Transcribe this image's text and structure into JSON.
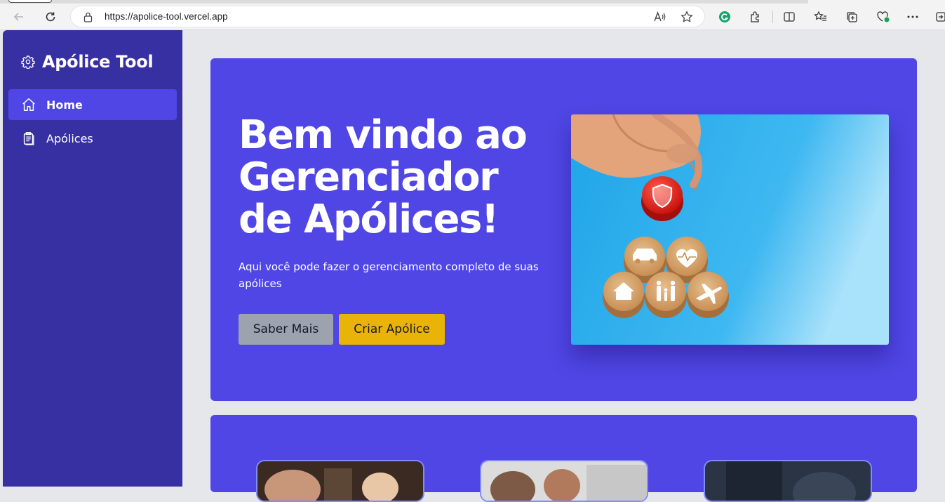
{
  "browser": {
    "url": "https://apolice-tool.vercel.app"
  },
  "sidebar": {
    "brand": "Apólice Tool",
    "items": [
      {
        "label": "Home",
        "icon": "home-icon",
        "active": true
      },
      {
        "label": "Apólices",
        "icon": "clipboard-icon",
        "active": false
      }
    ]
  },
  "hero": {
    "title": "Bem vindo ao Gerenciador de Apólices!",
    "subtitle": "Aqui você pode fazer o gerenciamento completo de suas apólices",
    "buttons": {
      "more": "Saber Mais",
      "create": "Criar Apólice"
    },
    "image_icons": [
      "shield-icon",
      "car-icon",
      "heart-pulse-icon",
      "house-icon",
      "family-icon",
      "airplane-icon"
    ]
  },
  "colors": {
    "sidebar": "#3730a3",
    "primary": "#4f46e5",
    "accent_yellow": "#eab308",
    "button_gray": "#9ca3af",
    "page_bg": "#e5e7eb"
  }
}
